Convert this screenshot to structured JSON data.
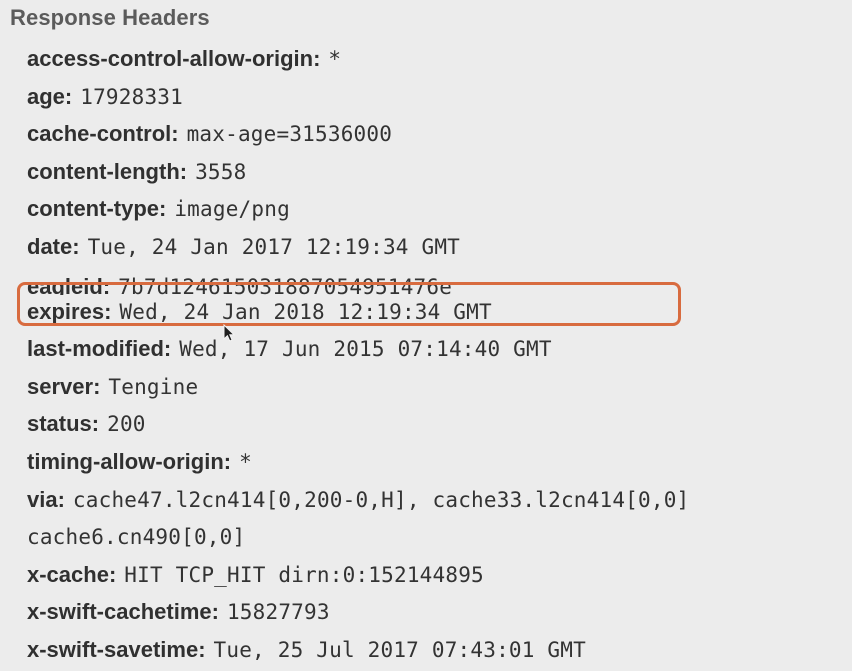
{
  "panel": {
    "title": "Response Headers"
  },
  "headers": [
    {
      "name": "access-control-allow-origin",
      "value": "*"
    },
    {
      "name": "age",
      "value": "17928331"
    },
    {
      "name": "cache-control",
      "value": "max-age=31536000"
    },
    {
      "name": "content-length",
      "value": "3558"
    },
    {
      "name": "content-type",
      "value": "image/png"
    },
    {
      "name": "date",
      "value": "Tue, 24 Jan 2017 12:19:34 GMT"
    },
    {
      "name": "eagleid",
      "value": "7b7d1246150318870549514​76e"
    },
    {
      "name": "expires",
      "value": "Wed, 24 Jan 2018 12:19:34 GMT"
    },
    {
      "name": "last-modified",
      "value": "Wed, 17 Jun 2015 07:14:40 GMT"
    },
    {
      "name": "server",
      "value": "Tengine"
    },
    {
      "name": "status",
      "value": "200"
    },
    {
      "name": "timing-allow-origin",
      "value": "*"
    },
    {
      "name": "via",
      "value": "cache47.l2cn414[0,200-0,H], cache33.l2cn414[0,0] cache6.cn490[0,0]"
    },
    {
      "name": "x-cache",
      "value": "HIT TCP_HIT dirn:0:152144895"
    },
    {
      "name": "x-swift-cachetime",
      "value": "15827793"
    },
    {
      "name": "x-swift-savetime",
      "value": "Tue, 25 Jul 2017 07:43:01 GMT"
    }
  ],
  "highlight": {
    "header": "expires",
    "color": "#d86b3f"
  },
  "cursor": {
    "icon": "mouse-pointer-icon"
  }
}
